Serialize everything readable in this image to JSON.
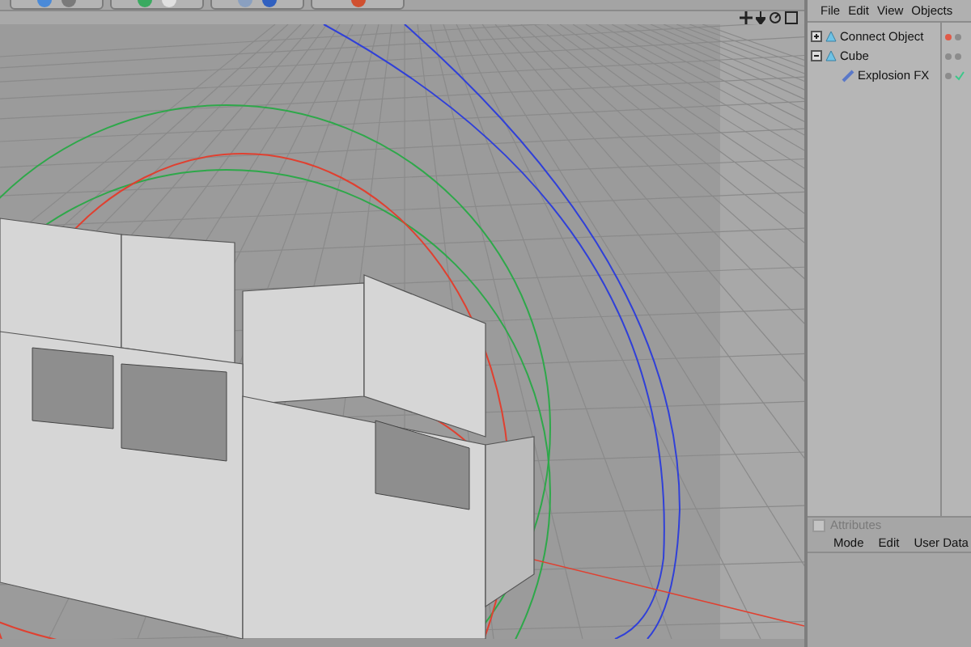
{
  "object_manager": {
    "menu": [
      "File",
      "Edit",
      "View",
      "Objects"
    ],
    "objects": [
      {
        "name": "Connect Object",
        "kind": "generator",
        "expanded": false,
        "color": "#e05a48",
        "checked": false
      },
      {
        "name": "Cube",
        "kind": "generator",
        "expanded": true,
        "color": "#8c8c8c",
        "checked": false,
        "children": [
          {
            "name": "Explosion FX",
            "kind": "deformer",
            "color": "#8c8c8c",
            "checked": true
          }
        ]
      }
    ]
  },
  "attributes": {
    "title": "Attributes",
    "menu": [
      "Mode",
      "Edit",
      "User Data"
    ]
  }
}
